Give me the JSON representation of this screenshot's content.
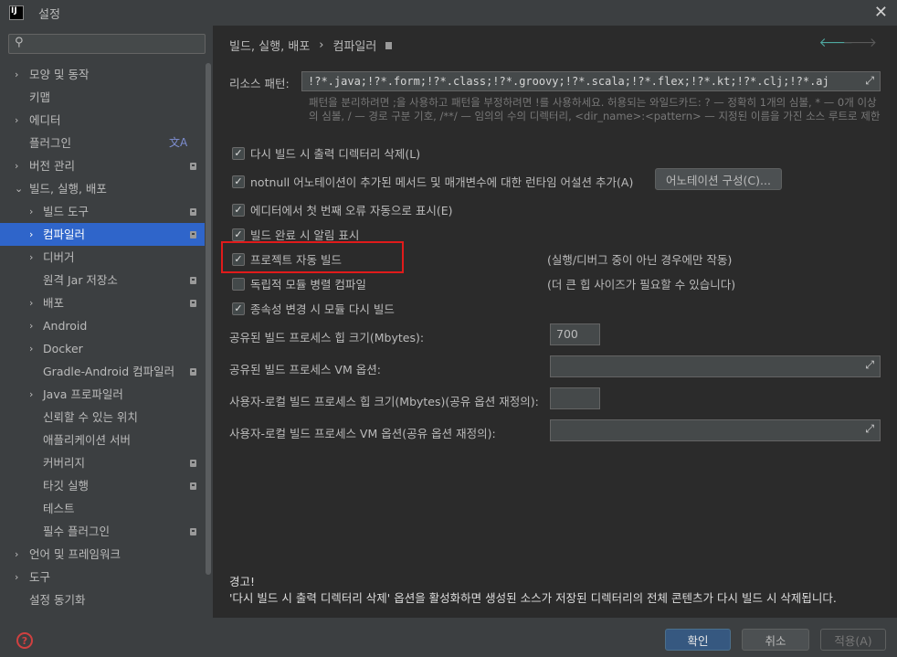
{
  "window": {
    "title": "설정",
    "app_icon": "IJ"
  },
  "sidebar": {
    "search_placeholder": "",
    "items": [
      {
        "label": "모양 및 동작",
        "level": 0,
        "arrow": "›",
        "badge": false
      },
      {
        "label": "키맵",
        "level": 0,
        "arrow": "",
        "badge": false
      },
      {
        "label": "에디터",
        "level": 0,
        "arrow": "›",
        "badge": false
      },
      {
        "label": "플러그인",
        "level": 0,
        "arrow": "",
        "badge": false,
        "translate": true
      },
      {
        "label": "버전 관리",
        "level": 0,
        "arrow": "›",
        "badge": true
      },
      {
        "label": "빌드, 실행, 배포",
        "level": 0,
        "arrow": "⌄",
        "badge": false
      },
      {
        "label": "빌드 도구",
        "level": 1,
        "arrow": "›",
        "badge": true
      },
      {
        "label": "컴파일러",
        "level": 1,
        "arrow": "›",
        "badge": true,
        "selected": true
      },
      {
        "label": "디버거",
        "level": 1,
        "arrow": "›",
        "badge": false
      },
      {
        "label": "원격 Jar 저장소",
        "level": 2,
        "arrow": "",
        "badge": true
      },
      {
        "label": "배포",
        "level": 1,
        "arrow": "›",
        "badge": true
      },
      {
        "label": "Android",
        "level": 1,
        "arrow": "›",
        "badge": false
      },
      {
        "label": "Docker",
        "level": 1,
        "arrow": "›",
        "badge": false
      },
      {
        "label": "Gradle-Android 컴파일러",
        "level": 2,
        "arrow": "",
        "badge": true
      },
      {
        "label": "Java 프로파일러",
        "level": 1,
        "arrow": "›",
        "badge": false
      },
      {
        "label": "신뢰할 수 있는 위치",
        "level": 2,
        "arrow": "",
        "badge": false
      },
      {
        "label": "애플리케이션 서버",
        "level": 2,
        "arrow": "",
        "badge": false
      },
      {
        "label": "커버리지",
        "level": 2,
        "arrow": "",
        "badge": true
      },
      {
        "label": "타깃 실행",
        "level": 2,
        "arrow": "",
        "badge": true
      },
      {
        "label": "테스트",
        "level": 2,
        "arrow": "",
        "badge": false
      },
      {
        "label": "필수 플러그인",
        "level": 2,
        "arrow": "",
        "badge": true
      },
      {
        "label": "언어 및 프레임워크",
        "level": 0,
        "arrow": "›",
        "badge": false
      },
      {
        "label": "도구",
        "level": 0,
        "arrow": "›",
        "badge": false
      },
      {
        "label": "설정 동기화",
        "level": 0,
        "arrow": "",
        "badge": false
      }
    ]
  },
  "breadcrumb": {
    "parent": "빌드, 실행, 배포",
    "separator": "›",
    "current": "컴파일러"
  },
  "resource_patterns": {
    "label": "리소스 패턴:",
    "value": "!?*.java;!?*.form;!?*.class;!?*.groovy;!?*.scala;!?*.flex;!?*.kt;!?*.clj;!?*.aj",
    "hint": "패턴을 분리하려면 ;을 사용하고 패턴을 부정하려면 !를 사용하세요. 허용되는 와일드카드: ? — 정확히 1개의 심볼, * — 0개 이상의 심볼, / — 경로 구분 기호, /**/ — 임의의 수의 디렉터리, <dir_name>:<pattern> — 지정된 이름을 가진 소스 루트로 제한"
  },
  "options": {
    "clear_output": "다시 빌드 시 출력 디렉터리 삭제(L)",
    "notnull": "notnull 어노테이션이 추가된 메서드 및 매개변수에 대한 런타임 어설션 추가(A)",
    "notnull_button": "어노테이션 구성(C)...",
    "auto_show_error": "에디터에서 첫 번째 오류 자동으로 표시(E)",
    "build_notify": "빌드 완료 시 알림 표시",
    "auto_build": "프로젝트 자동 빌드",
    "auto_build_note": "(실행/디버그 중이 아닌 경우에만 작동)",
    "parallel": "독립적 모듈 병렬 컴파일",
    "parallel_note": "(더 큰 힙 사이즈가 필요할 수 있습니다)",
    "rebuild_deps": "종속성 변경 시 모듈 다시 빌드"
  },
  "heap": {
    "shared_heap_label": "공유된 빌드 프로세스 힙 크기(Mbytes):",
    "shared_heap_value": "700",
    "shared_vm_label": "공유된 빌드 프로세스 VM 옵션:",
    "user_heap_label": "사용자-로컬 빌드 프로세스 힙 크기(Mbytes)(공유 옵션 재정의):",
    "user_vm_label": "사용자-로컬 빌드 프로세스 VM 옵션(공유 옵션 재정의):"
  },
  "warning": {
    "title": "경고!",
    "text": "'다시 빌드 시 출력 디렉터리 삭제' 옵션을 활성화하면 생성된 소스가 저장된 디렉터리의 전체 콘텐츠가 다시 빌드 시 삭제됩니다."
  },
  "footer": {
    "ok": "확인",
    "cancel": "취소",
    "apply": "적용(A)"
  },
  "colors": {
    "accent": "#2f65ca",
    "highlight": "#e01b1b",
    "primary_button": "#365880"
  }
}
